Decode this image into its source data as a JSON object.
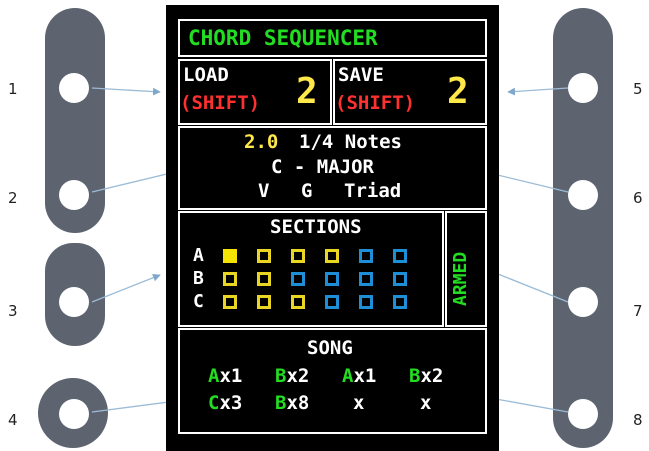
{
  "callouts": [
    "1",
    "2",
    "3",
    "4",
    "5",
    "6",
    "7",
    "8"
  ],
  "title": "CHORD SEQUENCER",
  "load": {
    "label": "LOAD",
    "shift": "(SHIFT)",
    "value": "2"
  },
  "save": {
    "label": "SAVE",
    "shift": "(SHIFT)",
    "value": "2"
  },
  "info": {
    "tempo": "2.0",
    "notes": "1/4 Notes",
    "key": "C - MAJOR",
    "degree": "V",
    "chord": "G",
    "type": "Triad"
  },
  "sections": {
    "title": "SECTIONS",
    "rows": [
      "A",
      "B",
      "C"
    ],
    "grid": [
      [
        "filled",
        "yellow",
        "yellow",
        "yellow",
        "blue",
        "blue"
      ],
      [
        "yellow",
        "yellow",
        "blue",
        "blue",
        "blue",
        "blue"
      ],
      [
        "yellow",
        "yellow",
        "yellow",
        "blue",
        "blue",
        "blue"
      ]
    ]
  },
  "armed": "ARMED",
  "song": {
    "title": "SONG",
    "steps": [
      {
        "section": "A",
        "times": "x1"
      },
      {
        "section": "B",
        "times": "x2"
      },
      {
        "section": "A",
        "times": "x1"
      },
      {
        "section": "B",
        "times": "x2"
      },
      {
        "section": "C",
        "times": "x3"
      },
      {
        "section": "B",
        "times": "x8"
      },
      {
        "section": "",
        "times": "x"
      },
      {
        "section": "",
        "times": "x"
      }
    ]
  },
  "colors": {
    "green": "#22dd22",
    "yellow": "#ffe84a",
    "red": "#ff3030",
    "blue": "#1e8fd6",
    "panel": "#000000",
    "hardware": "#5d6470"
  }
}
